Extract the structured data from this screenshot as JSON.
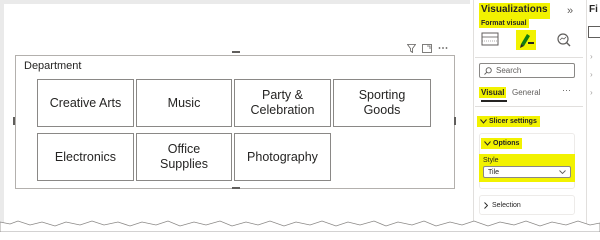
{
  "slicer": {
    "title": "Department",
    "tiles": [
      {
        "label": "Creative Arts"
      },
      {
        "label": "Music"
      },
      {
        "label": "Party &\nCelebration"
      },
      {
        "label": "Sporting\nGoods"
      },
      {
        "label": "Electronics"
      },
      {
        "label": "Office\nSupplies"
      },
      {
        "label": "Photography"
      }
    ]
  },
  "panel": {
    "title": "Visualizations",
    "format_visual": "Format visual",
    "search_placeholder": "Search",
    "tabs": {
      "visual": "Visual",
      "general": "General",
      "more": "···"
    },
    "sections": {
      "slicer_settings": "Slicer settings",
      "options": "Options",
      "style_label": "Style",
      "style_value": "Tile",
      "selection": "Selection"
    },
    "collapse_icon": "»"
  },
  "strip": {
    "letter": "Fi"
  },
  "colors": {
    "highlight": "#f2f200",
    "accent_icon": "#107c10"
  }
}
